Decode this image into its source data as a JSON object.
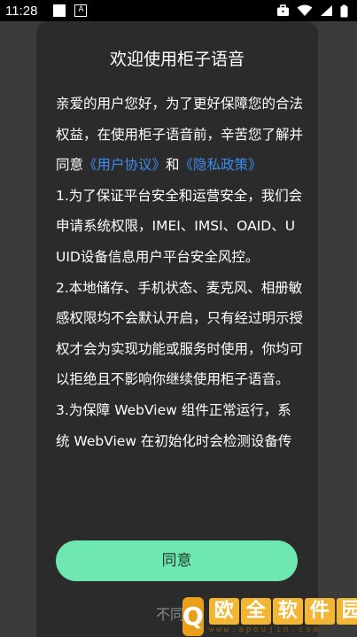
{
  "status_bar": {
    "time": "11:28",
    "notification_icon_letter": "A",
    "icons": [
      "notification-square-icon",
      "notification-a-icon",
      "briefcase-icon",
      "wifi-icon",
      "signal-icon",
      "battery-icon"
    ]
  },
  "dialog": {
    "title": "欢迎使用柜子语音",
    "intro_before": "亲爱的用户您好，为了更好保障您的合法权益，在使用柜子语音前，辛苦您了解并同意",
    "link_user_agreement": "《用户协议》",
    "and_text": "和",
    "link_privacy_policy": "《隐私政策》",
    "item1": "1.为了保证平台安全和运营安全，我们会申请系统权限，IMEI、IMSI、OAID、UUID设备信息用户平台安全风控。",
    "item2": "2.本地储存、手机状态、麦克风、相册敏感权限均不会默认开启，只有经过明示授权才会为实现功能或服务时使用，你均可以拒绝且不影响你继续使用柜子语音。",
    "item3": "3.为保障 WebView 组件正常运行，系统 WebView 在初始化时会检测设备传",
    "agree_label": "同意",
    "disagree_label": "不同意"
  },
  "watermark": {
    "logo_letter": "Q",
    "chars": [
      "欧",
      "全",
      "软",
      "件",
      "园"
    ],
    "url": "www.apoujin.com"
  },
  "colors": {
    "background": "#3b3b3b",
    "dialog": "#2b2b2b",
    "link": "#3d8bf0",
    "agree_button": "#6ee7b0"
  }
}
